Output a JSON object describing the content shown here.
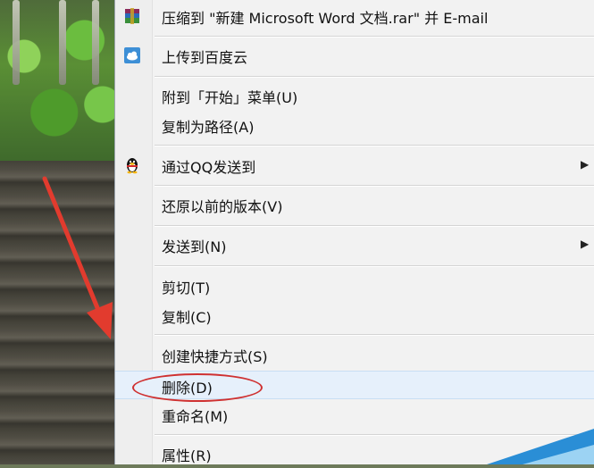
{
  "context_menu": {
    "items": [
      {
        "label": "压缩到 \"新建 Microsoft Word 文档.rar\" 并 E-mail",
        "icon": "winrar-icon"
      },
      {
        "label": "上传到百度云",
        "icon": "baidu-cloud-icon"
      },
      {
        "label": "附到「开始」菜单(U)"
      },
      {
        "label": "复制为路径(A)"
      },
      {
        "label": "通过QQ发送到",
        "icon": "qq-penguin-icon",
        "submenu": true
      },
      {
        "label": "还原以前的版本(V)"
      },
      {
        "label": "发送到(N)",
        "submenu": true
      },
      {
        "label": "剪切(T)"
      },
      {
        "label": "复制(C)"
      },
      {
        "label": "创建快捷方式(S)"
      },
      {
        "label": "删除(D)",
        "highlighted": true
      },
      {
        "label": "重命名(M)"
      },
      {
        "label": "属性(R)"
      }
    ],
    "submenu_arrow": "▶"
  },
  "annotations": {
    "arrow_color": "#e23b2e",
    "circle_color": "#cf3131"
  }
}
